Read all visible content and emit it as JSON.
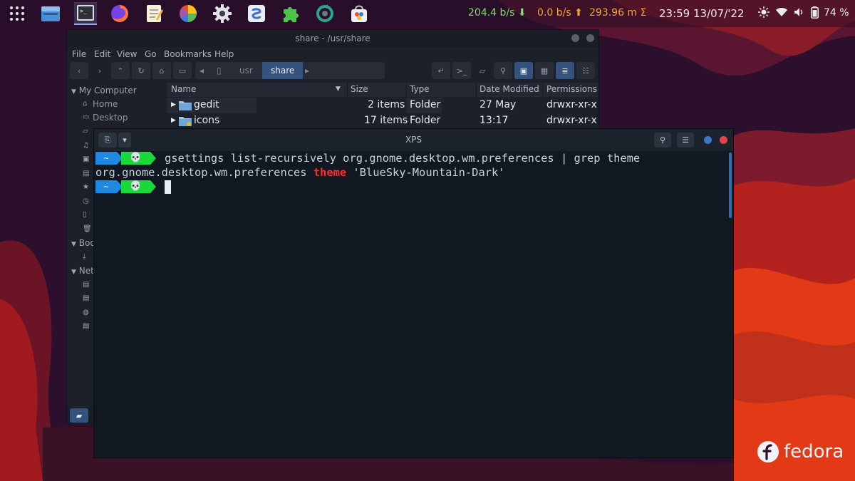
{
  "panel": {
    "launchers": [
      "app-grid-icon",
      "files-icon",
      "terminal-icon",
      "firefox-icon",
      "text-editor-icon",
      "disk-usage-icon",
      "settings-icon",
      "software-sources-icon",
      "extensions-icon",
      "update-icon",
      "software-center-icon"
    ],
    "net_down": "204.4 b/s",
    "net_up": "0.0 b/s",
    "total": "293.96 m Σ",
    "time": "23:59",
    "date": "13/07/'22",
    "battery": "74 %",
    "colors": {
      "down": "#7ddf6a",
      "up": "#f5a623",
      "total": "#f5a623"
    }
  },
  "file_manager": {
    "title": "share - /usr/share",
    "menu": [
      "File",
      "Edit",
      "View",
      "Go",
      "Bookmarks",
      "Help"
    ],
    "path": [
      "usr",
      "share"
    ],
    "sidebar": {
      "section_computer": "My Computer",
      "items": [
        "Home",
        "Desktop"
      ],
      "section_bookmarks": "Boo",
      "section_network": "Net"
    },
    "columns": [
      "Name",
      "Size",
      "Type",
      "Date Modified",
      "Permissions"
    ],
    "rows": [
      {
        "name": "gedit",
        "size": "2 items",
        "type": "Folder",
        "modified": "27 May",
        "permissions": "drwxr-xr-x"
      },
      {
        "name": "icons",
        "size": "17 items",
        "type": "Folder",
        "modified": "13:17",
        "permissions": "drwxr-xr-x"
      }
    ]
  },
  "terminal": {
    "title": "XPS",
    "prompt_dir": "~",
    "prompt_icon": "💀",
    "command": "gsettings list-recursively org.gnome.desktop.wm.preferences | grep theme",
    "output_prefix": "org.gnome.desktop.wm.preferences ",
    "output_keyword": "theme",
    "output_suffix": " 'BlueSky-Mountain-Dark'",
    "colors": {
      "dir_segment": "#1e88e5",
      "skull_segment": "#18d83a",
      "match": "#ff2a2a"
    }
  },
  "branding": {
    "logo_text": "fedora"
  }
}
